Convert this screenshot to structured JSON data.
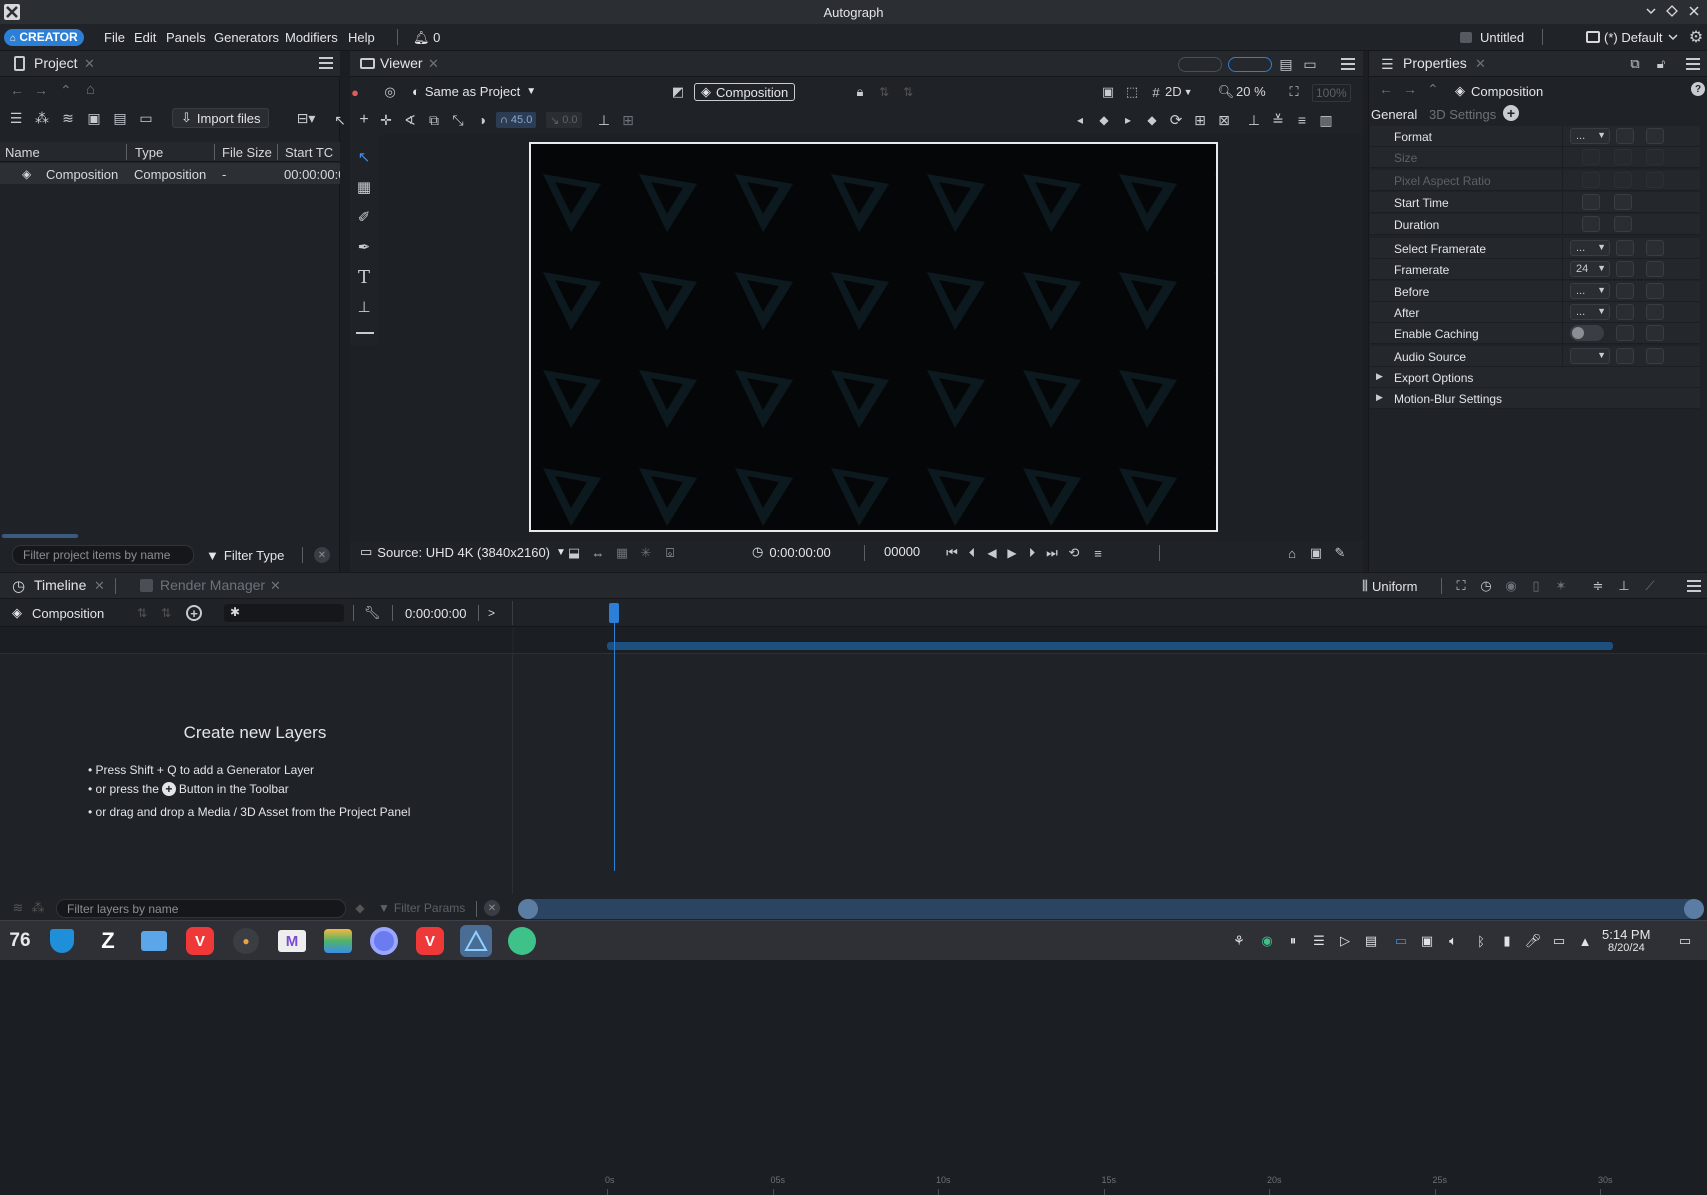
{
  "app": {
    "title": "Autograph",
    "badge": "CREATOR"
  },
  "menu": [
    "File",
    "Edit",
    "Panels",
    "Generators",
    "Modifiers",
    "Help"
  ],
  "notifications": "0",
  "project_name": "Untitled",
  "workspace": "(*) Default",
  "project_panel": {
    "tab": "Project",
    "import_label": "Import files",
    "columns": [
      "Name",
      "Type",
      "File Size",
      "Start TC"
    ],
    "rows": [
      {
        "name": "Composition",
        "type": "Composition",
        "size": "-",
        "start_tc": "00:00:00:0"
      }
    ],
    "filter_placeholder": "Filter project items by name",
    "filter_type": "Filter Type"
  },
  "viewer": {
    "tab": "Viewer",
    "color_space": "Same as Project",
    "composition_label": "Composition",
    "mode": "2D",
    "zoom": "20 %",
    "zoom_fit": "100%",
    "angle": "45.0",
    "offset": "0.0",
    "source": "Source: UHD 4K (3840x2160)",
    "timecode": "0:00:00:00",
    "frame": "00000"
  },
  "properties": {
    "tab": "Properties",
    "target": "Composition",
    "tabs": [
      "General",
      "3D Settings"
    ],
    "rows": [
      {
        "label": "Format",
        "value": "...",
        "disabled": false
      },
      {
        "label": "Size",
        "value": "",
        "disabled": true
      },
      {
        "label": "Pixel Aspect Ratio",
        "value": "",
        "disabled": true
      },
      {
        "label": "Start Time",
        "value": "",
        "disabled": false
      },
      {
        "label": "Duration",
        "value": "",
        "disabled": false
      },
      {
        "label": "Select Framerate",
        "value": "...",
        "disabled": false
      },
      {
        "label": "Framerate",
        "value": "24",
        "disabled": false
      },
      {
        "label": "Before",
        "value": "...",
        "disabled": false
      },
      {
        "label": "After",
        "value": "...",
        "disabled": false
      },
      {
        "label": "Enable Caching",
        "value": "",
        "disabled": false
      },
      {
        "label": "Audio Source",
        "value": "",
        "disabled": false
      },
      {
        "label": "Export Options",
        "value": "",
        "disabled": false
      },
      {
        "label": "Motion-Blur Settings",
        "value": "",
        "disabled": false
      }
    ]
  },
  "timeline": {
    "tab": "Timeline",
    "render_tab": "Render Manager",
    "mode": "Uniform",
    "composition": "Composition",
    "timecode": "0:00:00:00",
    "ruler": [
      "0s",
      "05s",
      "10s",
      "15s",
      "20s",
      "25s",
      "30s"
    ],
    "empty_title": "Create new Layers",
    "hint1": "• Press Shift + Q to add a Generator Layer",
    "hint2a": "• or press the",
    "hint2b": "Button in the Toolbar",
    "hint3": "• or drag and drop a Media / 3D Asset from the Project Panel",
    "filter_layers_placeholder": "Filter layers by name",
    "filter_params": "Filter Params"
  },
  "taskbar": {
    "clock_time": "5:14 PM",
    "clock_date": "8/20/24",
    "apps": [
      "76",
      "Z"
    ]
  }
}
